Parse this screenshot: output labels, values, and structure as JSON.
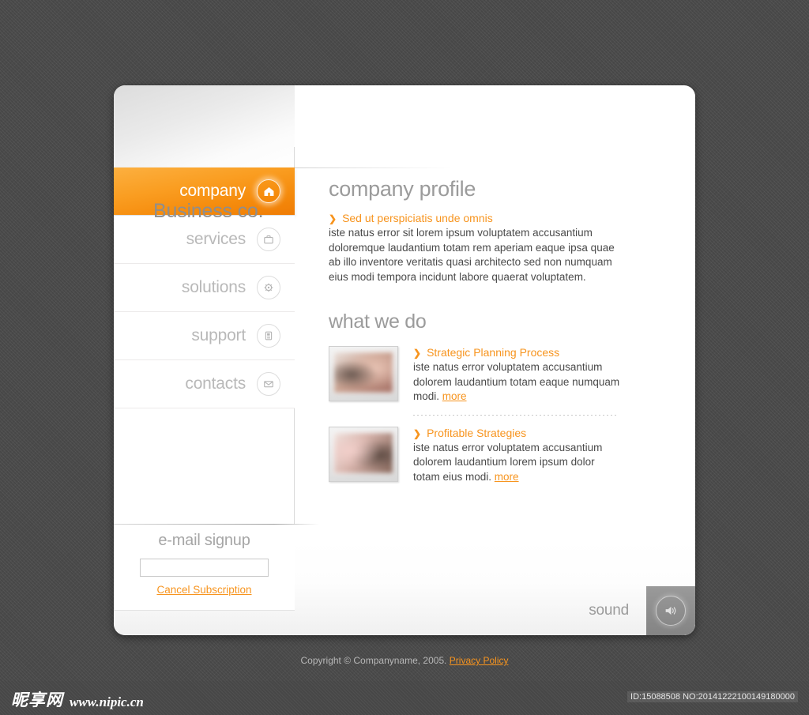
{
  "brand": {
    "title": "Business co."
  },
  "nav": {
    "items": [
      {
        "label": "company",
        "icon": "home-icon",
        "active": true
      },
      {
        "label": "services",
        "icon": "briefcase-icon",
        "active": false
      },
      {
        "label": "solutions",
        "icon": "gear-icon",
        "active": false
      },
      {
        "label": "support",
        "icon": "document-icon",
        "active": false
      },
      {
        "label": "contacts",
        "icon": "envelope-icon",
        "active": false
      }
    ]
  },
  "signup": {
    "title": "e-mail signup",
    "input_value": "",
    "input_placeholder": "",
    "cancel_label": "Cancel Subscription"
  },
  "content": {
    "profile_title": "company profile",
    "profile_bullet": "Sed ut perspiciatis unde omnis",
    "profile_body": "iste natus error sit lorem ipsum voluptatem accusantium doloremque laudantium totam rem aperiam eaque ipsa quae ab illo inventore veritatis quasi architecto  sed non numquam eius modi tempora incidunt labore quaerat voluptatem.",
    "what_we_do_title": "what we do",
    "items": [
      {
        "heading": "Strategic Planning Process",
        "body": "iste natus error voluptatem accusantium dolorem laudantium totam eaque numquam modi. ",
        "more_label": "more"
      },
      {
        "heading": "Profitable Strategies",
        "body": "iste natus error voluptatem accusantium dolorem laudantium lorem ipsum dolor totam eius modi. ",
        "more_label": "more"
      }
    ]
  },
  "footer": {
    "sound_label": "sound",
    "sound_icon": "speaker-icon",
    "copyright": "Copyright © Companyname, 2005. ",
    "privacy_label": "Privacy Policy"
  },
  "watermark": {
    "cn_text": "昵享网",
    "url": "www.nipic.cn",
    "id_text": "ID:15088508 NO:20141222100149180000"
  },
  "colors": {
    "accent": "#f7941e",
    "accent_dark": "#ef7c05",
    "page_bg": "#4d4d4d",
    "card_bg": "#ffffff",
    "muted_text": "#9b9b9b",
    "body_text": "#4a4a4a",
    "sound_bg": "#8d8d8d"
  }
}
